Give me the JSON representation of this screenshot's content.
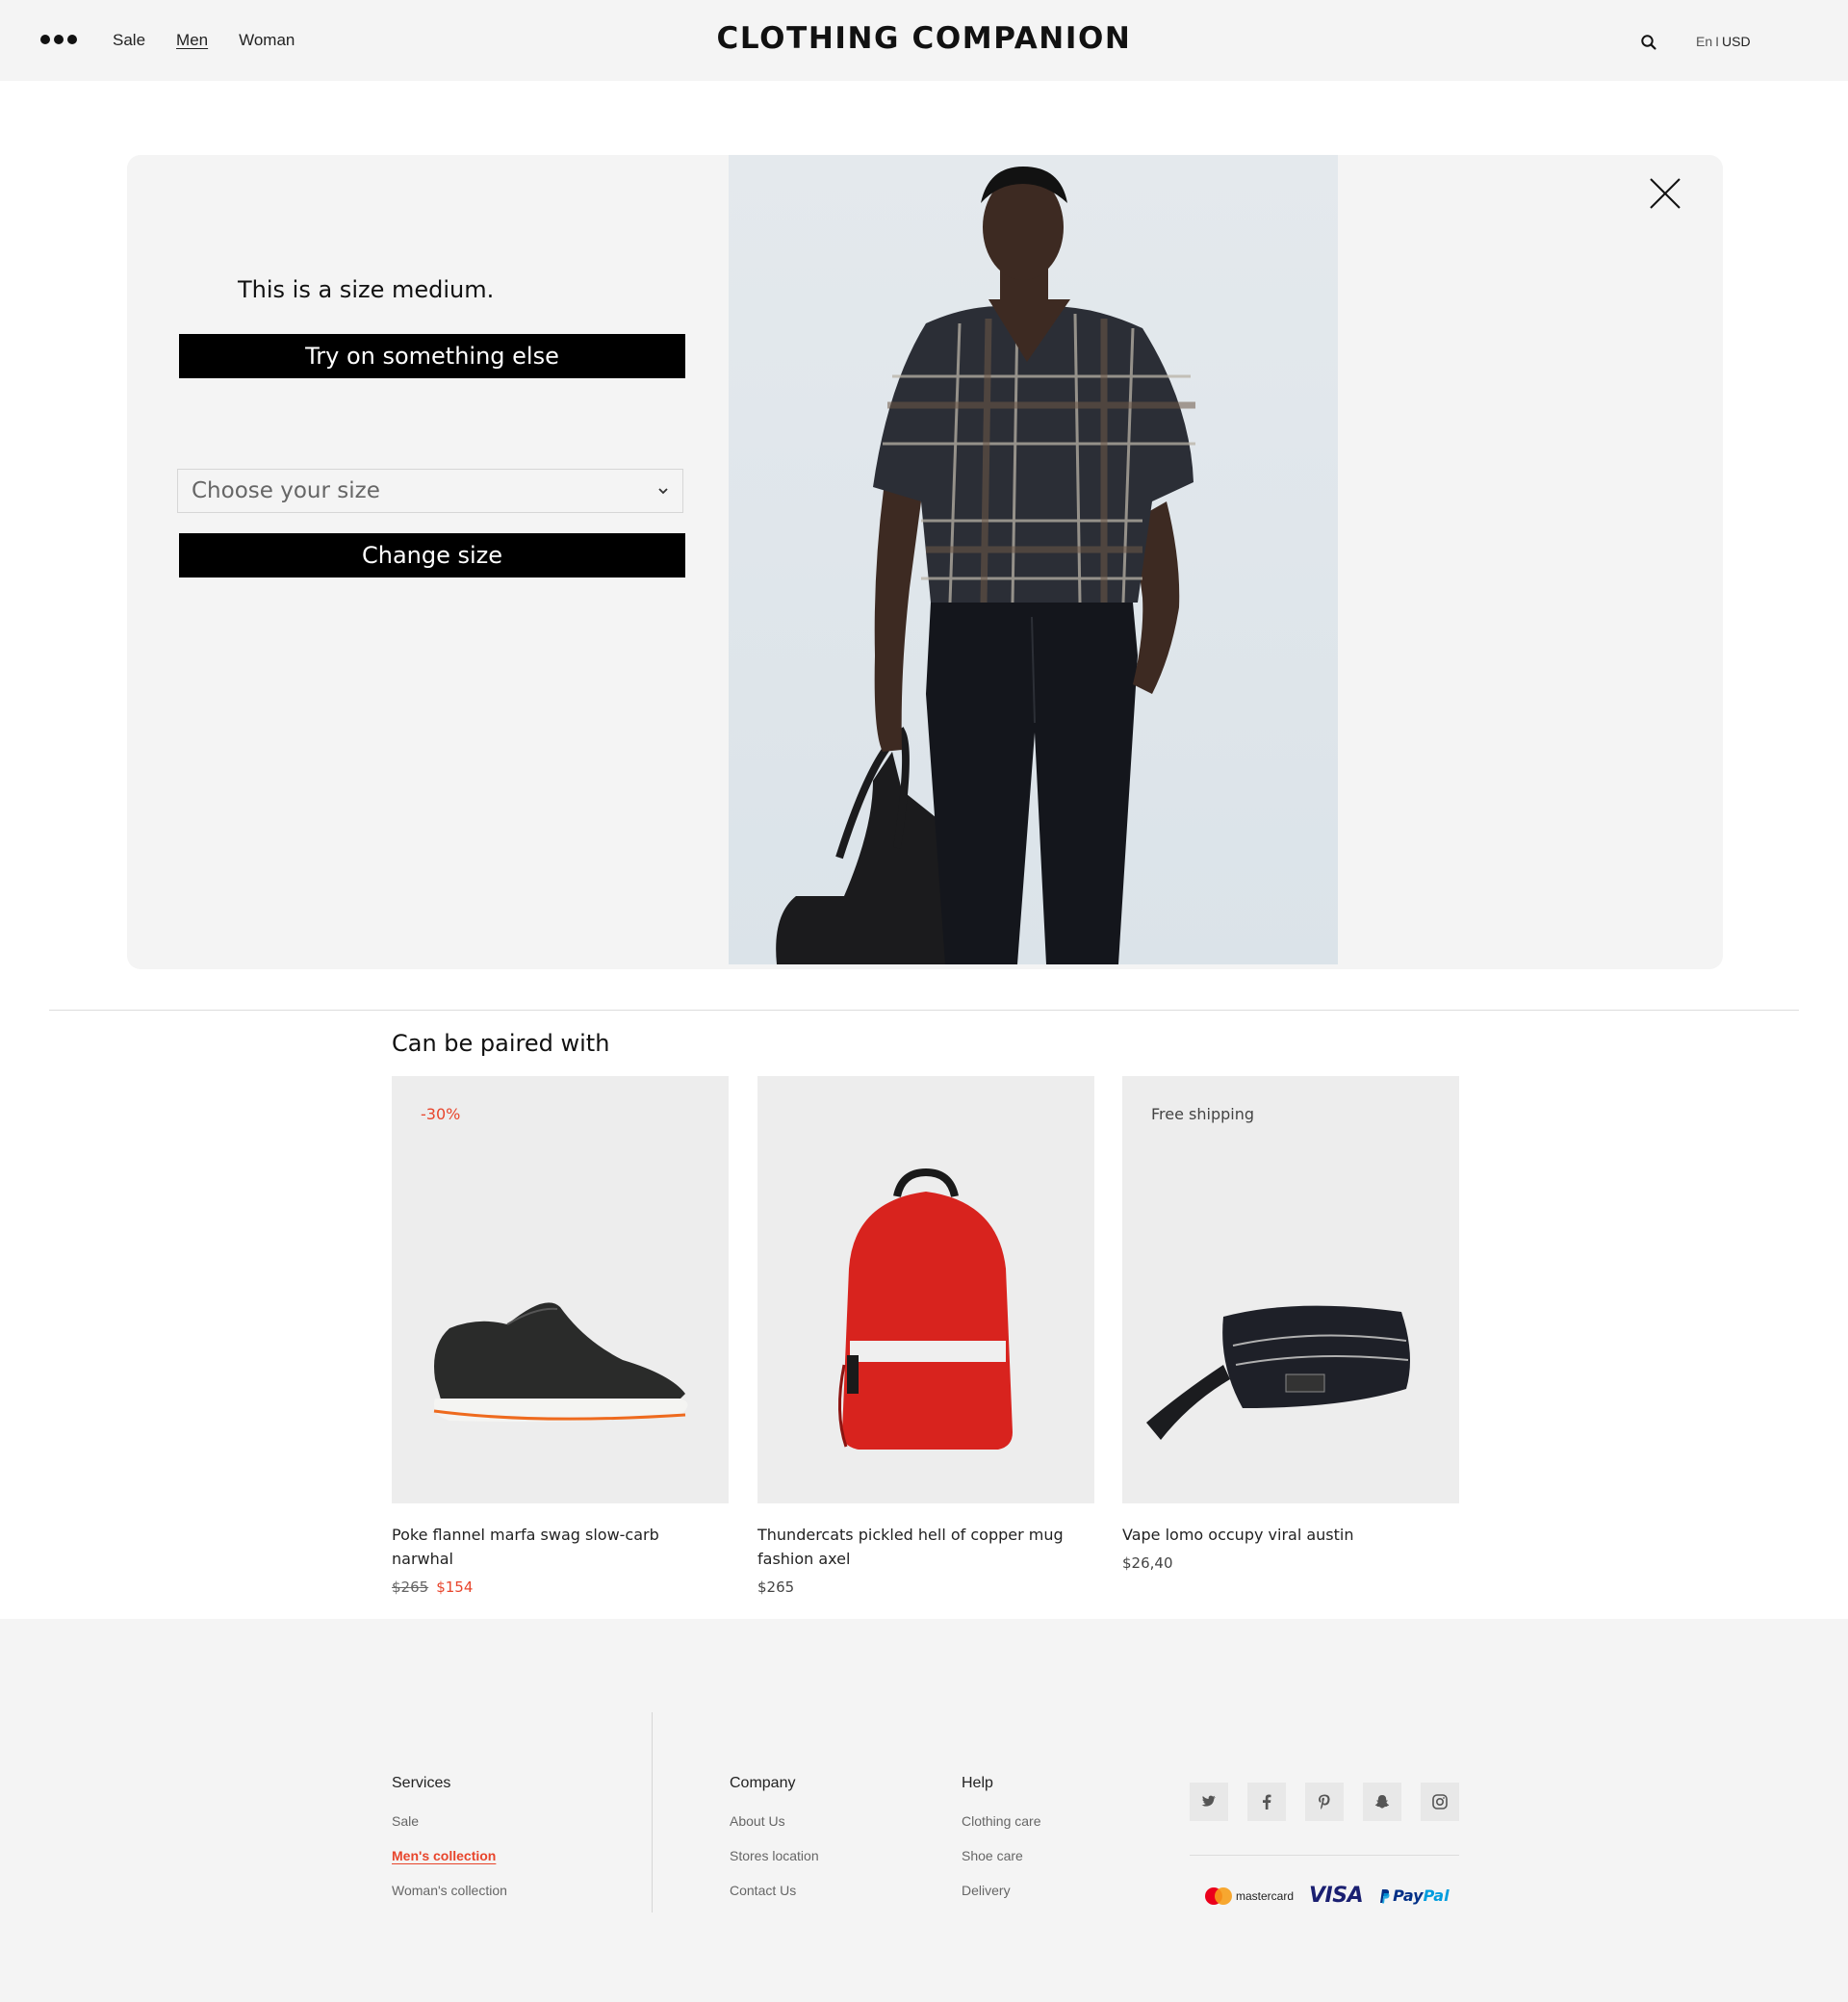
{
  "header": {
    "nav": [
      "Sale",
      "Men",
      "Woman"
    ],
    "active_nav": "Men",
    "brand": "CLOTHING COMPANION",
    "locale": {
      "lang": "En",
      "separator": "I",
      "currency": "USD"
    }
  },
  "modal": {
    "size_message": "This is a size medium.",
    "try_button": "Try on something else",
    "size_select_placeholder": "Choose your size",
    "change_button": "Change size"
  },
  "paired": {
    "title": "Can be paired with",
    "items": [
      {
        "tag": "-30%",
        "name": "Poke flannel marfa swag slow-carb narwhal",
        "old_price": "$265",
        "price": "$154",
        "image": "sneaker"
      },
      {
        "tag": "",
        "name": "Thundercats pickled hell of copper mug fashion axel",
        "old_price": "",
        "price": "$265",
        "image": "red-backpack"
      },
      {
        "tag": "Free shipping",
        "name": "Vape lomo occupy viral austin",
        "old_price": "",
        "price": "$26,40",
        "image": "belt-bag"
      }
    ]
  },
  "footer": {
    "services": {
      "title": "Services",
      "links": [
        "Sale",
        "Men's collection",
        "Woman's collection"
      ],
      "active": "Men's collection"
    },
    "company": {
      "title": "Company",
      "links": [
        "About Us",
        "Stores location",
        "Contact Us"
      ]
    },
    "help": {
      "title": "Help",
      "links": [
        "Clothing care",
        "Shoe care",
        "Delivery"
      ]
    },
    "socials": [
      "twitter-icon",
      "facebook-icon",
      "pinterest-icon",
      "snapchat-icon",
      "instagram-icon"
    ],
    "payments": {
      "mastercard": "mastercard",
      "visa": "VISA",
      "paypal_pay": "Pay",
      "paypal_pal": "Pal"
    }
  },
  "colors": {
    "accent": "#e8452c",
    "panel": "#f4f4f4",
    "button": "#000000"
  }
}
